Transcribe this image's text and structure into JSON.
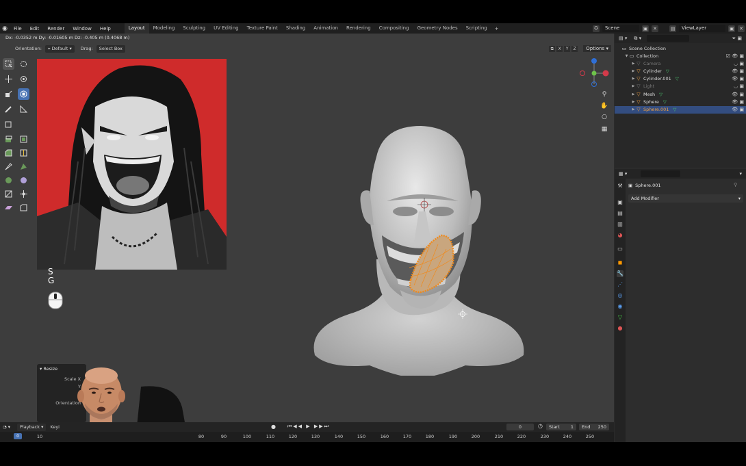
{
  "topbar": {
    "menus": [
      "File",
      "Edit",
      "Render",
      "Window",
      "Help"
    ],
    "workspaces": [
      "Layout",
      "Modeling",
      "Sculpting",
      "UV Editing",
      "Texture Paint",
      "Shading",
      "Animation",
      "Rendering",
      "Compositing",
      "Geometry Nodes",
      "Scripting"
    ],
    "active_workspace": "Layout",
    "scene": "Scene",
    "view_layer": "ViewLayer"
  },
  "viewport": {
    "status_text": "Dx: -0.0352 m  Dy: -0.01605 m  Dz: -0.405 m (0.4068 m)",
    "orientation_label": "Orientation:",
    "orientation_value": "Default",
    "drag_label": "Drag:",
    "drag_value": "Select Box",
    "axis_buttons": [
      "X",
      "Y",
      "Z"
    ],
    "options_label": "Options",
    "keys_pressed": [
      "S",
      "G"
    ]
  },
  "operator_panel": {
    "title": "Resize",
    "labels": [
      "Scale X",
      "Y",
      "Z",
      "Orientation"
    ]
  },
  "timeline": {
    "playback_label": "Playback",
    "keying_label": "Keyi",
    "current_frame": "0",
    "cursor_frame": "0",
    "start_label": "Start",
    "start_value": "1",
    "end_label": "End",
    "end_value": "250",
    "ruler_ticks": [
      "10",
      "80",
      "90",
      "100",
      "110",
      "120",
      "130",
      "140",
      "150",
      "160",
      "170",
      "180",
      "190",
      "200",
      "210",
      "220",
      "230",
      "240",
      "250"
    ]
  },
  "outliner": {
    "root": "Scene Collection",
    "collection": "Collection",
    "items": [
      {
        "name": "Camera",
        "dim": true,
        "color": "#777777"
      },
      {
        "name": "Cylinder",
        "dim": false,
        "color": "#f0a040"
      },
      {
        "name": "Cylinder.001",
        "dim": false,
        "color": "#f0a040"
      },
      {
        "name": "Light",
        "dim": true,
        "color": "#777777"
      },
      {
        "name": "Mesh",
        "dim": false,
        "color": "#f0a040"
      },
      {
        "name": "Sphere",
        "dim": false,
        "color": "#f0a040"
      },
      {
        "name": "Sphere.001",
        "dim": false,
        "color": "#f0a040",
        "selected": true
      }
    ]
  },
  "properties": {
    "object_name": "Sphere.001",
    "add_modifier": "Add Modifier"
  },
  "colors": {
    "accent": "#4772b3",
    "selection_orange": "#f08a1c",
    "viewport_bg": "#3d3d3d"
  }
}
